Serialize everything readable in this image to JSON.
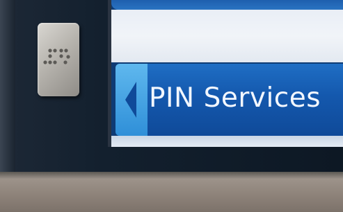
{
  "kiosk": {
    "braille_plate": {
      "icon": "braille-icon"
    },
    "screen": {
      "option": {
        "label": "PIN Services",
        "arrow_icon": "chevron-left-icon"
      }
    }
  },
  "colors": {
    "button_blue": "#1458ad",
    "arrow_tab_blue": "#3b9ee3",
    "screen_white": "#eef2f7",
    "frame_dark": "#13202e"
  }
}
